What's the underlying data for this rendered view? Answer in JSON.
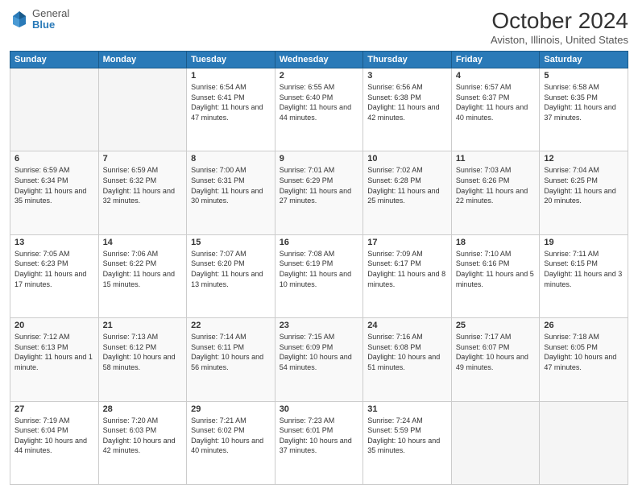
{
  "header": {
    "logo_general": "General",
    "logo_blue": "Blue",
    "month_title": "October 2024",
    "location": "Aviston, Illinois, United States"
  },
  "weekdays": [
    "Sunday",
    "Monday",
    "Tuesday",
    "Wednesday",
    "Thursday",
    "Friday",
    "Saturday"
  ],
  "weeks": [
    [
      {
        "day": "",
        "sunrise": "",
        "sunset": "",
        "daylight": ""
      },
      {
        "day": "",
        "sunrise": "",
        "sunset": "",
        "daylight": ""
      },
      {
        "day": "1",
        "sunrise": "Sunrise: 6:54 AM",
        "sunset": "Sunset: 6:41 PM",
        "daylight": "Daylight: 11 hours and 47 minutes."
      },
      {
        "day": "2",
        "sunrise": "Sunrise: 6:55 AM",
        "sunset": "Sunset: 6:40 PM",
        "daylight": "Daylight: 11 hours and 44 minutes."
      },
      {
        "day": "3",
        "sunrise": "Sunrise: 6:56 AM",
        "sunset": "Sunset: 6:38 PM",
        "daylight": "Daylight: 11 hours and 42 minutes."
      },
      {
        "day": "4",
        "sunrise": "Sunrise: 6:57 AM",
        "sunset": "Sunset: 6:37 PM",
        "daylight": "Daylight: 11 hours and 40 minutes."
      },
      {
        "day": "5",
        "sunrise": "Sunrise: 6:58 AM",
        "sunset": "Sunset: 6:35 PM",
        "daylight": "Daylight: 11 hours and 37 minutes."
      }
    ],
    [
      {
        "day": "6",
        "sunrise": "Sunrise: 6:59 AM",
        "sunset": "Sunset: 6:34 PM",
        "daylight": "Daylight: 11 hours and 35 minutes."
      },
      {
        "day": "7",
        "sunrise": "Sunrise: 6:59 AM",
        "sunset": "Sunset: 6:32 PM",
        "daylight": "Daylight: 11 hours and 32 minutes."
      },
      {
        "day": "8",
        "sunrise": "Sunrise: 7:00 AM",
        "sunset": "Sunset: 6:31 PM",
        "daylight": "Daylight: 11 hours and 30 minutes."
      },
      {
        "day": "9",
        "sunrise": "Sunrise: 7:01 AM",
        "sunset": "Sunset: 6:29 PM",
        "daylight": "Daylight: 11 hours and 27 minutes."
      },
      {
        "day": "10",
        "sunrise": "Sunrise: 7:02 AM",
        "sunset": "Sunset: 6:28 PM",
        "daylight": "Daylight: 11 hours and 25 minutes."
      },
      {
        "day": "11",
        "sunrise": "Sunrise: 7:03 AM",
        "sunset": "Sunset: 6:26 PM",
        "daylight": "Daylight: 11 hours and 22 minutes."
      },
      {
        "day": "12",
        "sunrise": "Sunrise: 7:04 AM",
        "sunset": "Sunset: 6:25 PM",
        "daylight": "Daylight: 11 hours and 20 minutes."
      }
    ],
    [
      {
        "day": "13",
        "sunrise": "Sunrise: 7:05 AM",
        "sunset": "Sunset: 6:23 PM",
        "daylight": "Daylight: 11 hours and 17 minutes."
      },
      {
        "day": "14",
        "sunrise": "Sunrise: 7:06 AM",
        "sunset": "Sunset: 6:22 PM",
        "daylight": "Daylight: 11 hours and 15 minutes."
      },
      {
        "day": "15",
        "sunrise": "Sunrise: 7:07 AM",
        "sunset": "Sunset: 6:20 PM",
        "daylight": "Daylight: 11 hours and 13 minutes."
      },
      {
        "day": "16",
        "sunrise": "Sunrise: 7:08 AM",
        "sunset": "Sunset: 6:19 PM",
        "daylight": "Daylight: 11 hours and 10 minutes."
      },
      {
        "day": "17",
        "sunrise": "Sunrise: 7:09 AM",
        "sunset": "Sunset: 6:17 PM",
        "daylight": "Daylight: 11 hours and 8 minutes."
      },
      {
        "day": "18",
        "sunrise": "Sunrise: 7:10 AM",
        "sunset": "Sunset: 6:16 PM",
        "daylight": "Daylight: 11 hours and 5 minutes."
      },
      {
        "day": "19",
        "sunrise": "Sunrise: 7:11 AM",
        "sunset": "Sunset: 6:15 PM",
        "daylight": "Daylight: 11 hours and 3 minutes."
      }
    ],
    [
      {
        "day": "20",
        "sunrise": "Sunrise: 7:12 AM",
        "sunset": "Sunset: 6:13 PM",
        "daylight": "Daylight: 11 hours and 1 minute."
      },
      {
        "day": "21",
        "sunrise": "Sunrise: 7:13 AM",
        "sunset": "Sunset: 6:12 PM",
        "daylight": "Daylight: 10 hours and 58 minutes."
      },
      {
        "day": "22",
        "sunrise": "Sunrise: 7:14 AM",
        "sunset": "Sunset: 6:11 PM",
        "daylight": "Daylight: 10 hours and 56 minutes."
      },
      {
        "day": "23",
        "sunrise": "Sunrise: 7:15 AM",
        "sunset": "Sunset: 6:09 PM",
        "daylight": "Daylight: 10 hours and 54 minutes."
      },
      {
        "day": "24",
        "sunrise": "Sunrise: 7:16 AM",
        "sunset": "Sunset: 6:08 PM",
        "daylight": "Daylight: 10 hours and 51 minutes."
      },
      {
        "day": "25",
        "sunrise": "Sunrise: 7:17 AM",
        "sunset": "Sunset: 6:07 PM",
        "daylight": "Daylight: 10 hours and 49 minutes."
      },
      {
        "day": "26",
        "sunrise": "Sunrise: 7:18 AM",
        "sunset": "Sunset: 6:05 PM",
        "daylight": "Daylight: 10 hours and 47 minutes."
      }
    ],
    [
      {
        "day": "27",
        "sunrise": "Sunrise: 7:19 AM",
        "sunset": "Sunset: 6:04 PM",
        "daylight": "Daylight: 10 hours and 44 minutes."
      },
      {
        "day": "28",
        "sunrise": "Sunrise: 7:20 AM",
        "sunset": "Sunset: 6:03 PM",
        "daylight": "Daylight: 10 hours and 42 minutes."
      },
      {
        "day": "29",
        "sunrise": "Sunrise: 7:21 AM",
        "sunset": "Sunset: 6:02 PM",
        "daylight": "Daylight: 10 hours and 40 minutes."
      },
      {
        "day": "30",
        "sunrise": "Sunrise: 7:23 AM",
        "sunset": "Sunset: 6:01 PM",
        "daylight": "Daylight: 10 hours and 37 minutes."
      },
      {
        "day": "31",
        "sunrise": "Sunrise: 7:24 AM",
        "sunset": "Sunset: 5:59 PM",
        "daylight": "Daylight: 10 hours and 35 minutes."
      },
      {
        "day": "",
        "sunrise": "",
        "sunset": "",
        "daylight": ""
      },
      {
        "day": "",
        "sunrise": "",
        "sunset": "",
        "daylight": ""
      }
    ]
  ]
}
